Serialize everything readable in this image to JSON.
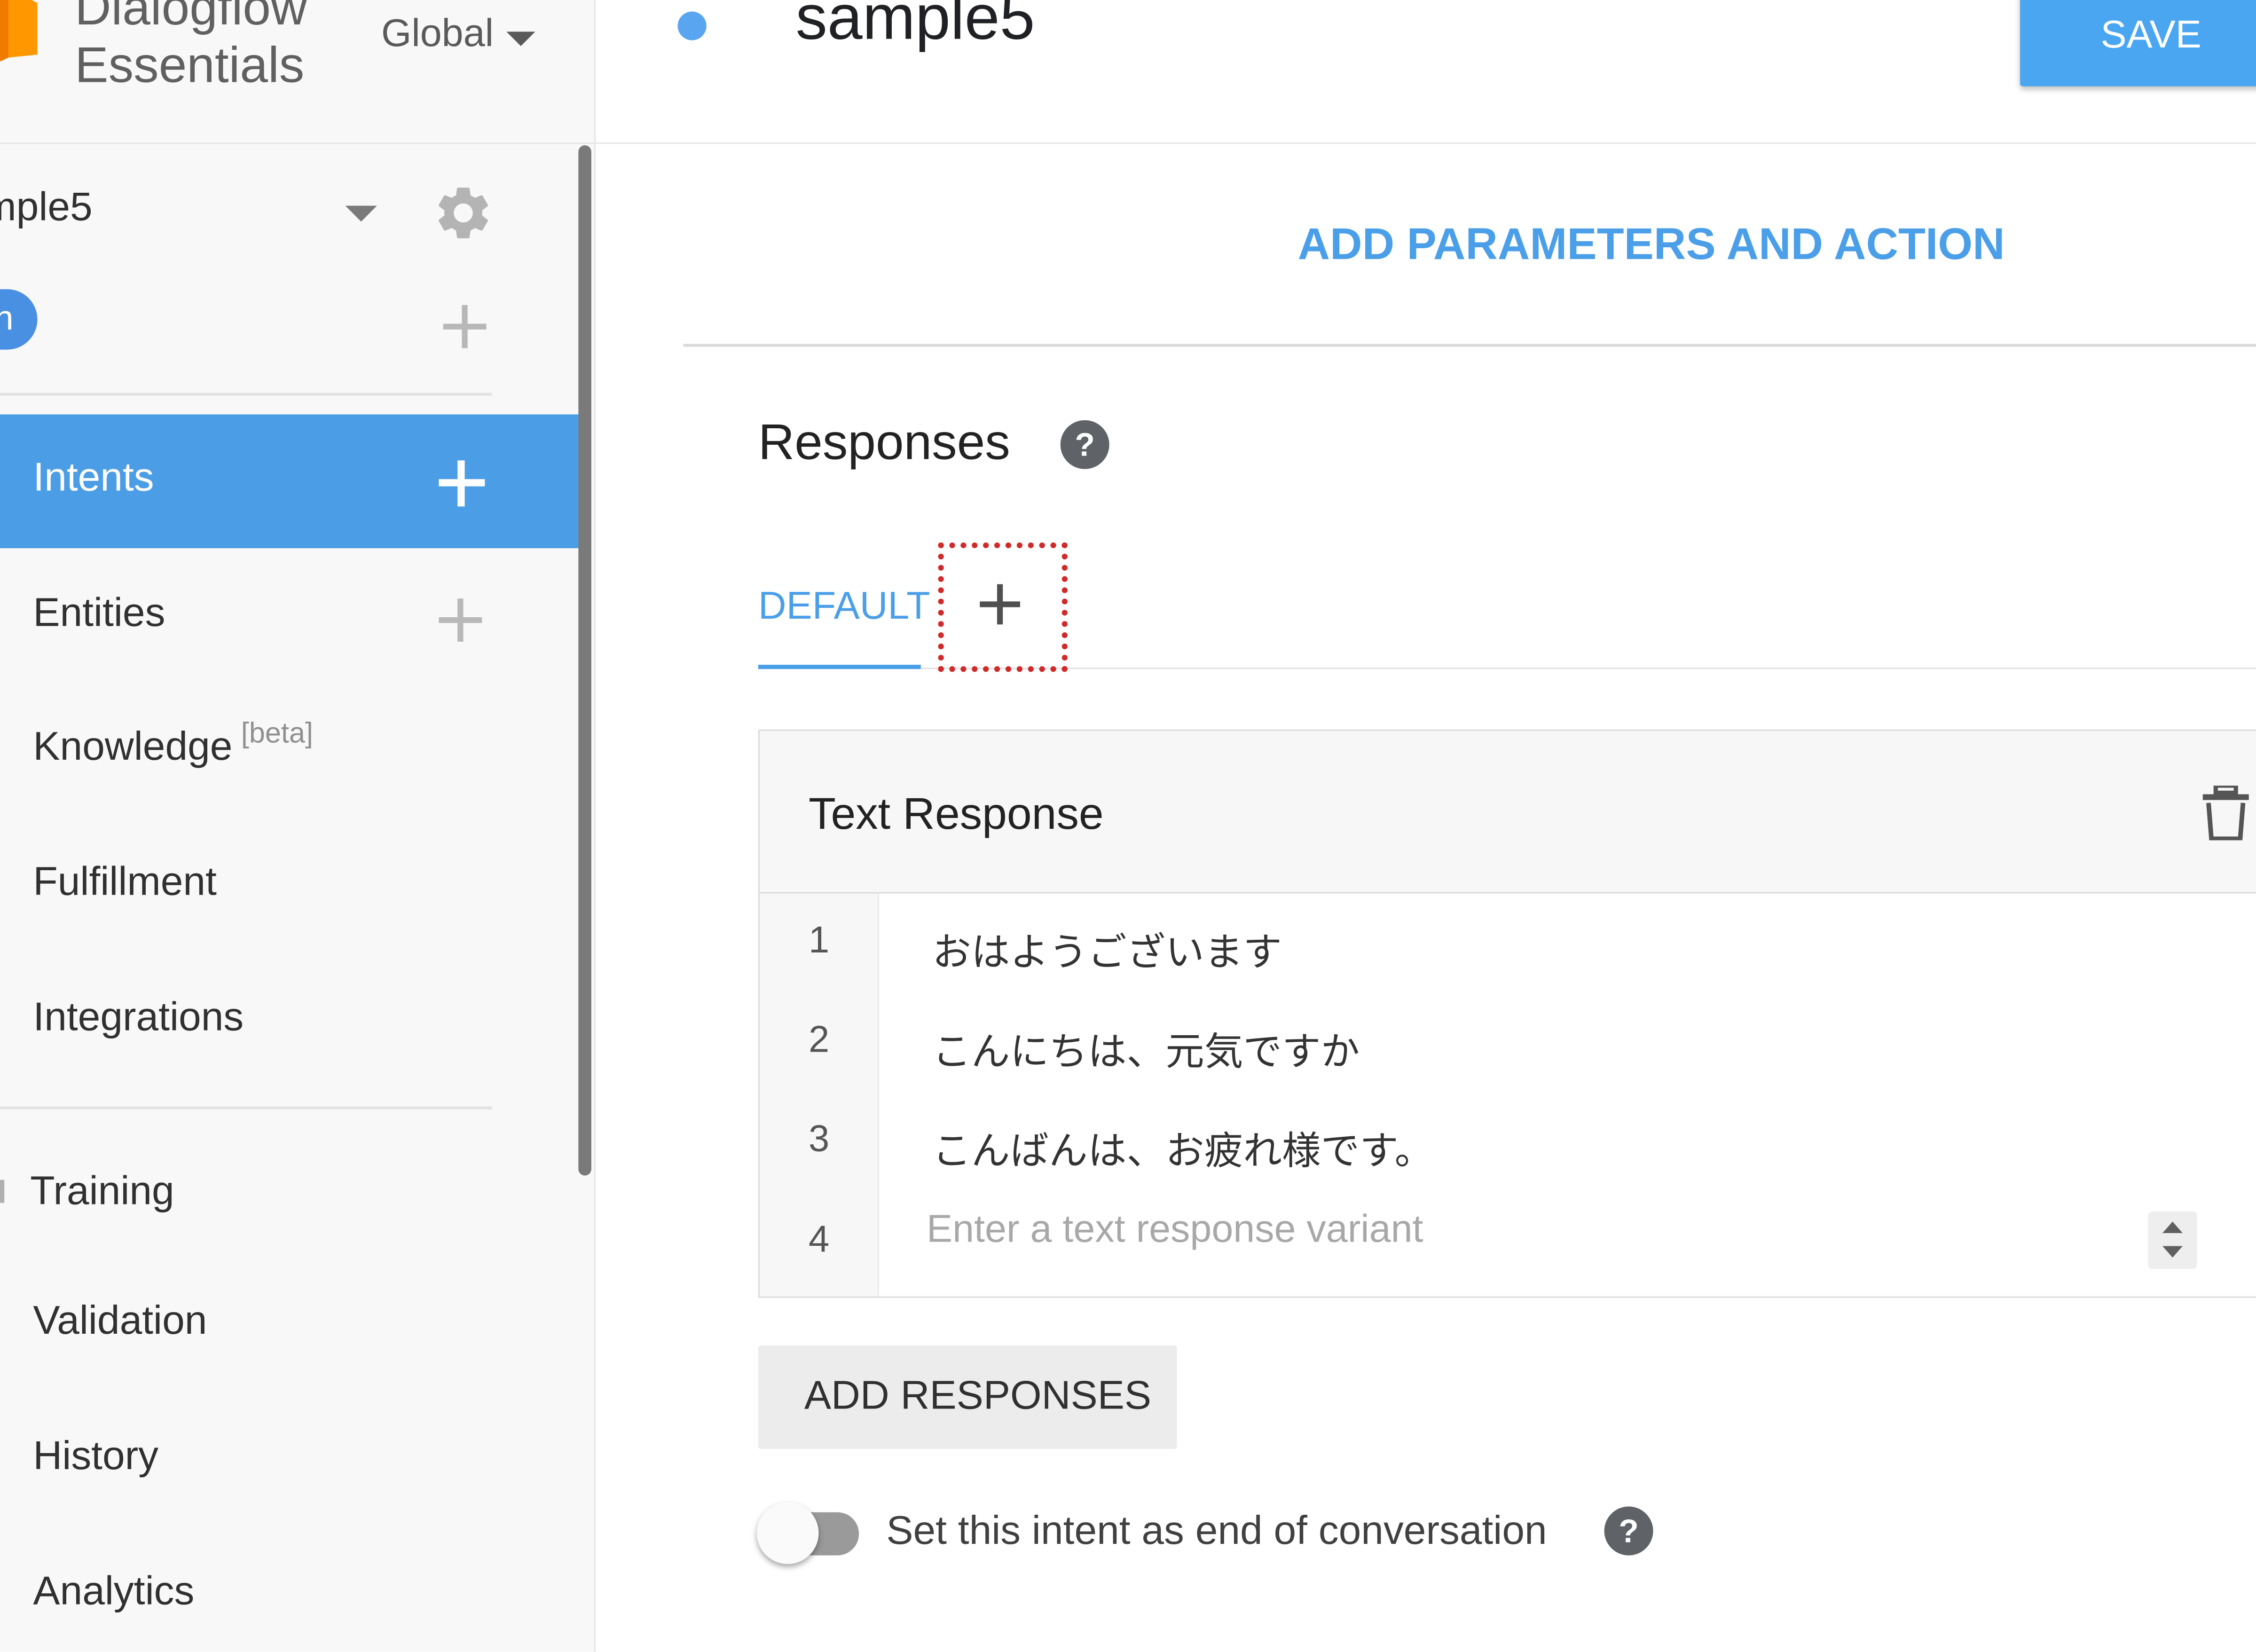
{
  "app": {
    "brand_line1": "Dialogflow",
    "brand_line2": "Essentials",
    "region": "Global"
  },
  "sidebar": {
    "agent_name": "mple5",
    "language_pill": "n",
    "nav": {
      "intents": "Intents",
      "entities": "Entities",
      "knowledge": "Knowledge",
      "knowledge_badge": "[beta]",
      "fulfillment": "Fulfillment",
      "integrations": "Integrations",
      "training": "Training",
      "validation": "Validation",
      "history": "History",
      "analytics": "Analytics"
    }
  },
  "header": {
    "intent_title": "sample5",
    "save_label": "SAVE"
  },
  "main": {
    "add_params_label": "ADD PARAMETERS AND ACTION",
    "responses_title": "Responses",
    "tabs": [
      {
        "label": "DEFAULT",
        "active": true
      }
    ],
    "text_response": {
      "title": "Text Response",
      "rows": [
        {
          "num": "1",
          "text": "おはようございます"
        },
        {
          "num": "2",
          "text": "こんにちは、元気ですか"
        },
        {
          "num": "3",
          "text": "こんばんは、お疲れ様です。"
        }
      ],
      "input_row_num": "4",
      "input_placeholder": "Enter a text response variant",
      "input_value": ""
    },
    "add_responses_label": "ADD RESPONSES",
    "end_conversation_label": "Set this intent as end of conversation",
    "end_conversation_enabled": false
  },
  "colors": {
    "accent": "#4a9fe8",
    "intents_active_bg": "#4b9de6",
    "save_bg": "#4aa6f0",
    "highlight_dotted": "#d02a2a",
    "logo_orange": "#ef7c00"
  }
}
